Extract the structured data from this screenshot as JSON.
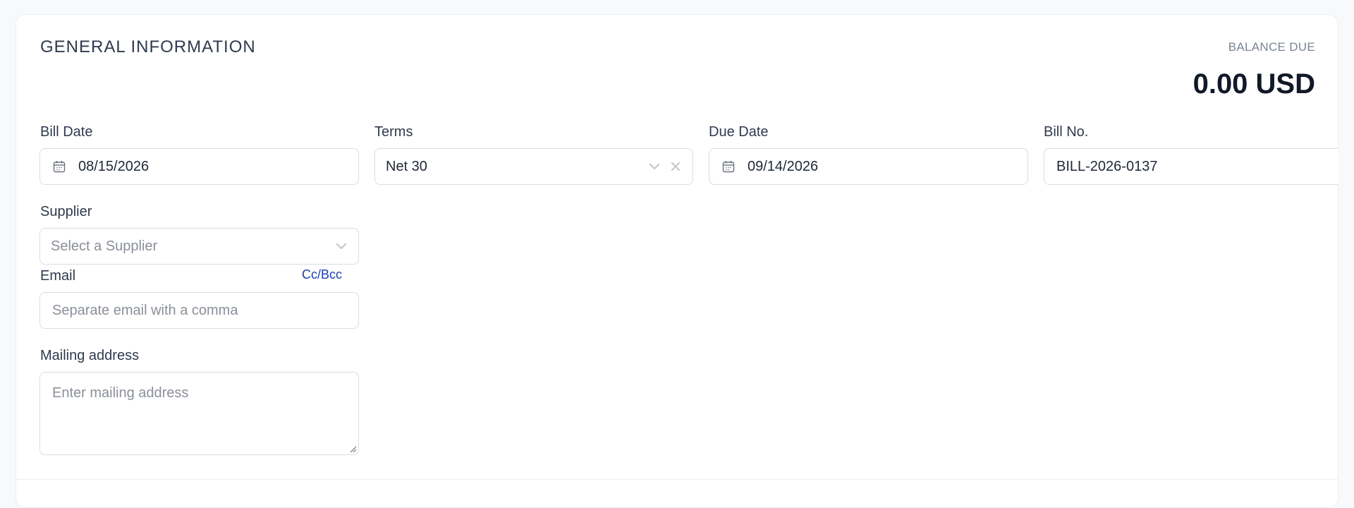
{
  "section": {
    "title": "GENERAL INFORMATION"
  },
  "balance": {
    "label": "BALANCE DUE",
    "amount": "0.00 USD"
  },
  "fields": {
    "bill_date": {
      "label": "Bill Date",
      "value": "08/15/2026",
      "icon": "calendar-icon"
    },
    "terms": {
      "label": "Terms",
      "value": "Net 30",
      "icons": [
        "chevron-down-icon",
        "clear-x-icon"
      ]
    },
    "due_date": {
      "label": "Due Date",
      "value": "09/14/2026",
      "icon": "calendar-icon"
    },
    "bill_no": {
      "label": "Bill No.",
      "value": "BILL-2026-0137"
    },
    "supplier": {
      "label": "Supplier",
      "placeholder": "Select a Supplier",
      "icon": "chevron-down-icon"
    },
    "email": {
      "label": "Email",
      "placeholder": "Separate email with a comma",
      "cc_bcc_link": "Cc/Bcc"
    },
    "mailing_address": {
      "label": "Mailing address",
      "placeholder": "Enter mailing address"
    }
  },
  "colors": {
    "link": "#1e3fae",
    "border": "#d9dde3",
    "placeholder": "#8a8f98"
  }
}
